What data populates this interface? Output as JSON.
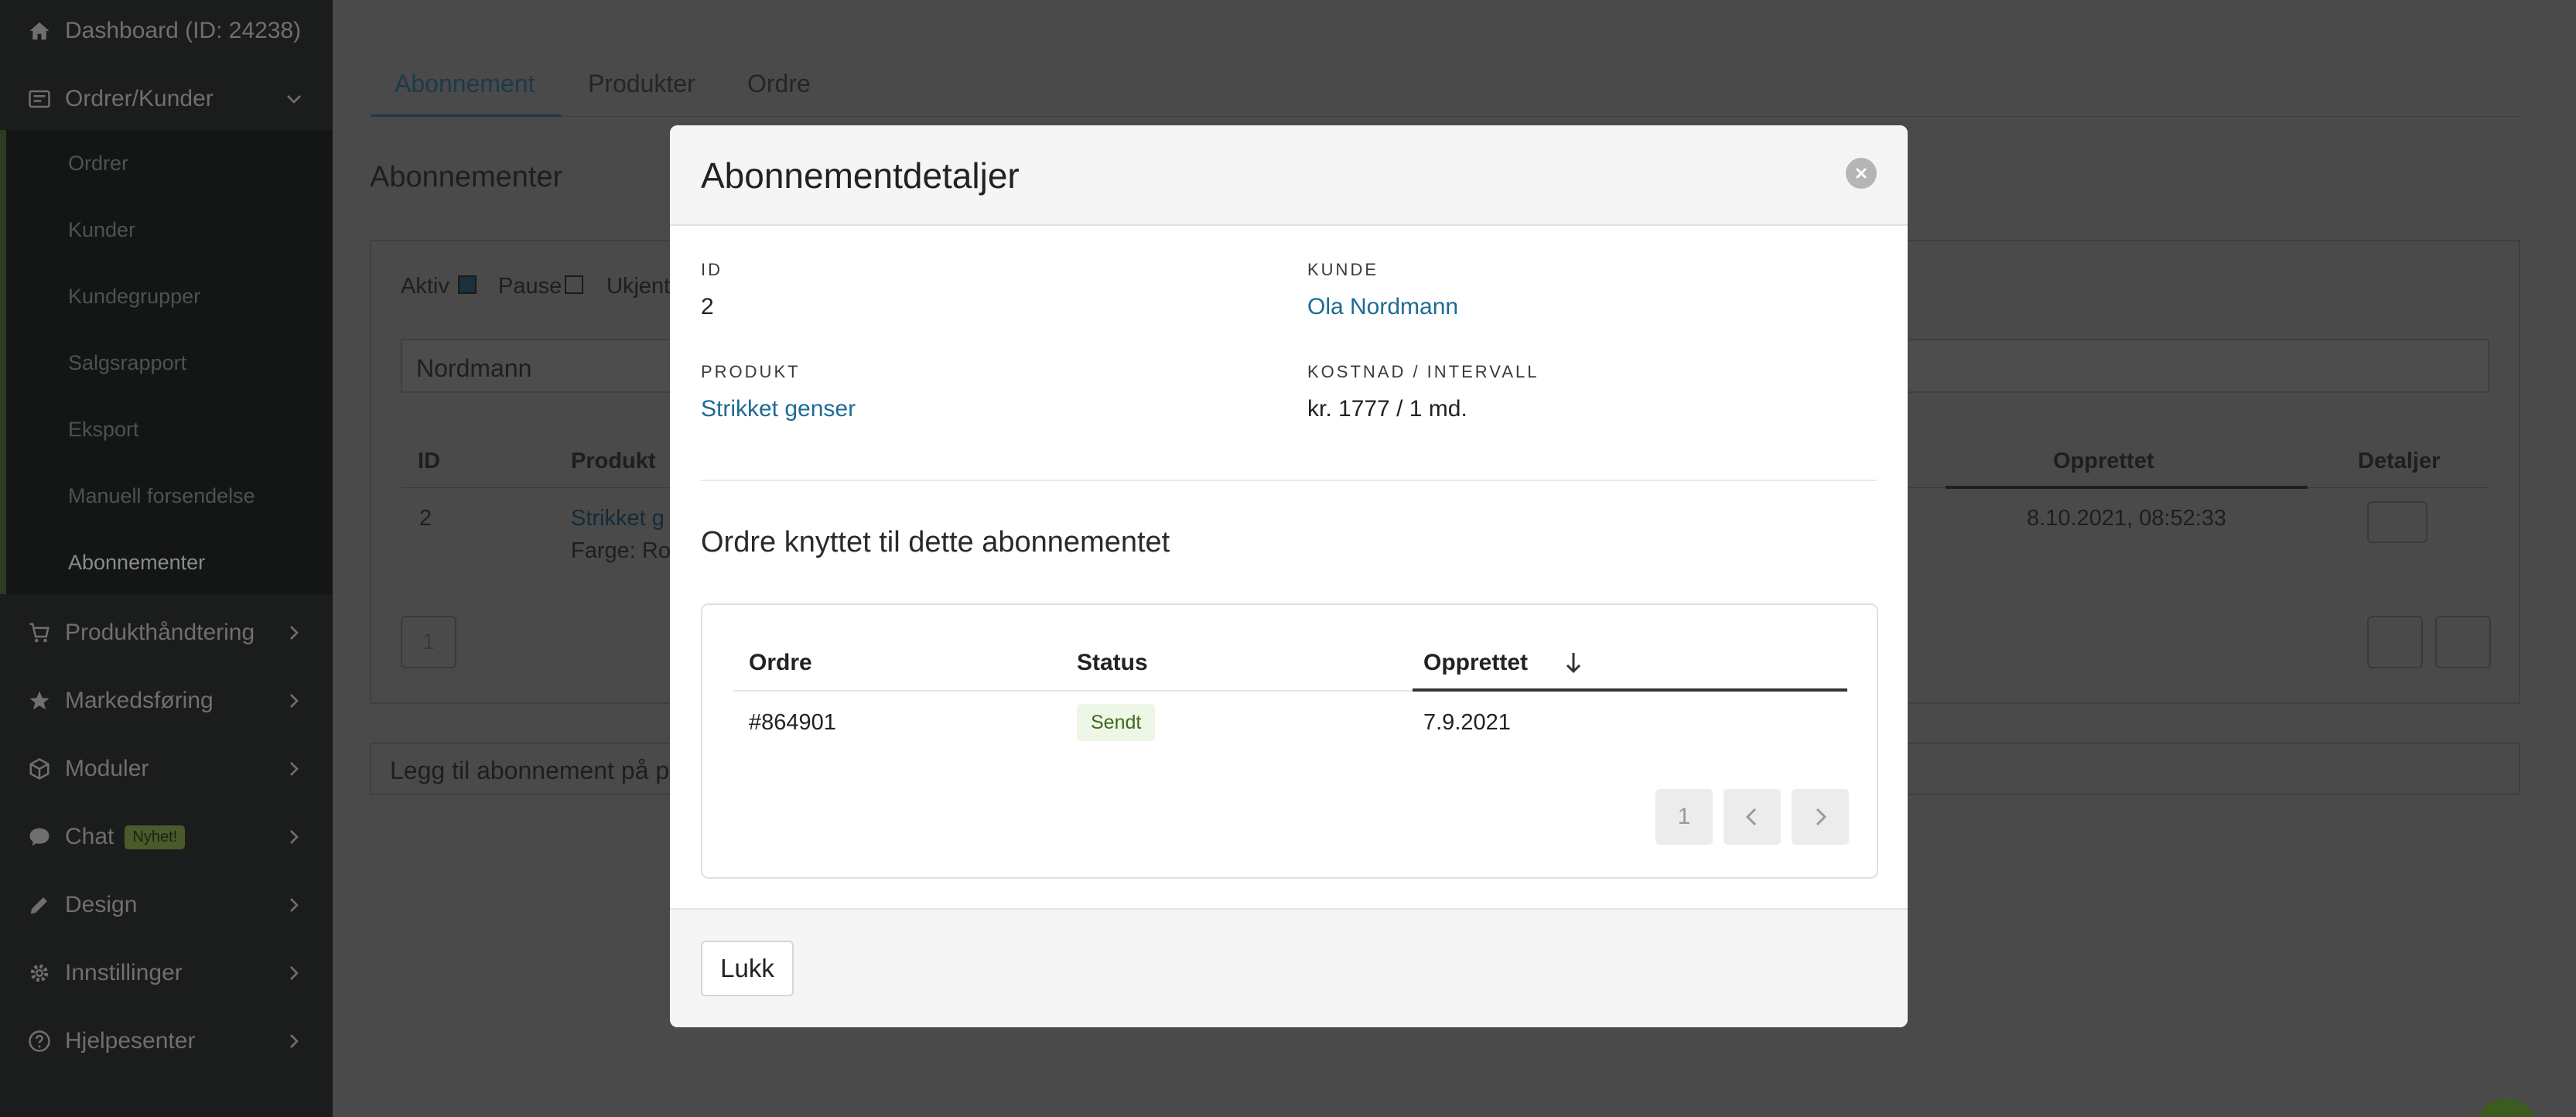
{
  "sidebar": {
    "dashboard": "Dashboard (ID: 24238)",
    "orders_customers": "Ordrer/Kunder",
    "sub_items": [
      "Ordrer",
      "Kunder",
      "Kundegrupper",
      "Salgsrapport",
      "Eksport",
      "Manuell forsendelse",
      "Abonnementer"
    ],
    "product_handling": "Produkthåndtering",
    "marketing": "Markedsføring",
    "modules": "Moduler",
    "chat": "Chat",
    "chat_badge": "Nyhet!",
    "design": "Design",
    "settings": "Innstillinger",
    "help": "Hjelpesenter"
  },
  "main": {
    "tabs": [
      "Abonnement",
      "Produkter",
      "Ordre"
    ],
    "page_title": "Abonnementer",
    "filters": {
      "active": "Aktiv",
      "pause": "Pause",
      "unknown": "Ukjent"
    },
    "search_value": "Nordmann",
    "table": {
      "headers": {
        "id": "ID",
        "product": "Produkt",
        "created": "Opprettet",
        "details": "Detaljer"
      },
      "row": {
        "id": "2",
        "product": "Strikket g",
        "variant": "Farge: Ros",
        "created": "8.10.2021, 08:52:33"
      }
    },
    "page_number": "1",
    "add_subscription": "Legg til abonnement på p"
  },
  "modal": {
    "title": "Abonnementdetaljer",
    "id_label": "ID",
    "id_value": "2",
    "customer_label": "KUNDE",
    "customer_value": "Ola Nordmann",
    "product_label": "PRODUKT",
    "product_value": "Strikket genser",
    "cost_label": "KOSTNAD / INTERVALL",
    "cost_value": "kr. 1777 / 1 md.",
    "orders_title": "Ordre knyttet til dette abonnementet",
    "orders_table": {
      "headers": {
        "order": "Ordre",
        "status": "Status",
        "created": "Opprettet"
      },
      "rows": [
        {
          "order": "#864901",
          "status": "Sendt",
          "created": "7.9.2021"
        }
      ]
    },
    "page_number": "1",
    "close_label": "Lukk"
  }
}
